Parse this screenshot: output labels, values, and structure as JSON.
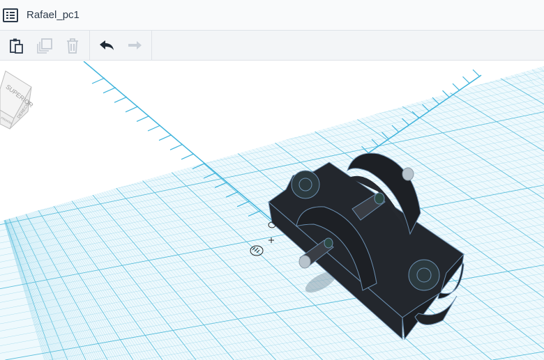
{
  "header": {
    "title": "Rafael_pc1",
    "menu_icon": "list-icon"
  },
  "toolbar": {
    "buttons": [
      {
        "name": "paste",
        "icon": "clipboard-icon",
        "enabled": true
      },
      {
        "name": "duplicate",
        "icon": "duplicate-icon",
        "enabled": false
      },
      {
        "name": "delete",
        "icon": "trash-icon",
        "enabled": false
      },
      {
        "name": "undo",
        "icon": "undo-icon",
        "enabled": true
      },
      {
        "name": "redo",
        "icon": "redo-icon",
        "enabled": false
      }
    ]
  },
  "viewcube": {
    "top": "SUPERIOR",
    "right": "DERECHA",
    "front": "FRONTAL"
  },
  "colors": {
    "grid": "#8fd3e8",
    "grid_major": "#5cbfdc",
    "ruler": "#3fb4dc",
    "object": "#23272d",
    "edge": "#6b8fb0",
    "toolbar_bg": "#f3f5f7"
  }
}
